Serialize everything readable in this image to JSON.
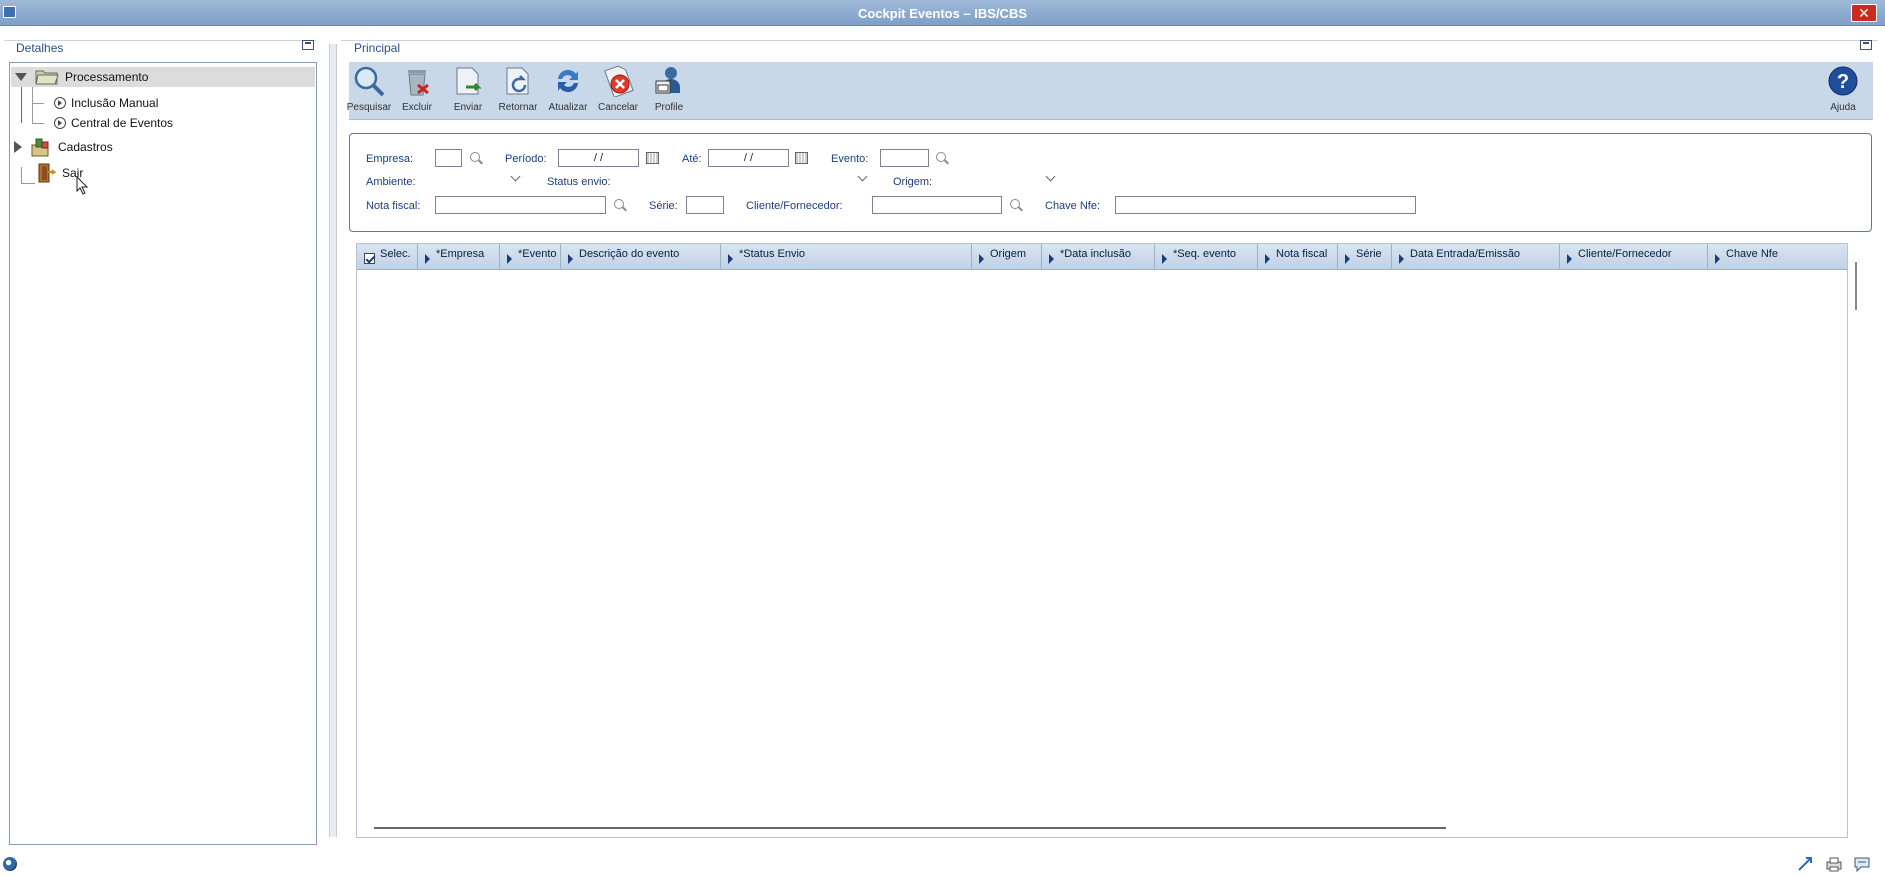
{
  "window": {
    "title": "Cockpit Eventos – IBS/CBS",
    "close_label": "✕"
  },
  "left": {
    "header": "Detalhes",
    "tree": [
      {
        "label": "Processamento"
      },
      {
        "label": "Inclusão Manual"
      },
      {
        "label": "Central de Eventos"
      },
      {
        "label": "Cadastros"
      },
      {
        "label": "Sair"
      }
    ]
  },
  "right": {
    "header": "Principal",
    "toolbar": [
      {
        "label": "Pesquisar",
        "icon": "search-icon"
      },
      {
        "label": "Excluir",
        "icon": "trash-icon"
      },
      {
        "label": "Enviar",
        "icon": "send-icon"
      },
      {
        "label": "Retornar",
        "icon": "return-icon"
      },
      {
        "label": "Atualizar",
        "icon": "refresh-icon"
      },
      {
        "label": "Cancelar",
        "icon": "cancel-icon"
      },
      {
        "label": "Profile",
        "icon": "profile-icon"
      }
    ],
    "help_label": "Ajuda",
    "filters": {
      "empresa_label": "Empresa:",
      "empresa_value": "",
      "periodo_label": "Período:",
      "periodo_value": "/ /",
      "ate_label": "Até:",
      "ate_value": "/ /",
      "evento_label": "Evento:",
      "evento_value": "",
      "ambiente_label": "Ambiente:",
      "status_envio_label": "Status envio:",
      "origem_label": "Origem:",
      "nota_fiscal_label": "Nota fiscal:",
      "nota_fiscal_value": "",
      "serie_label": "Série:",
      "serie_value": "",
      "cliente_label": "Cliente/Fornecedor:",
      "cliente_value": "",
      "chave_label": "Chave Nfe:",
      "chave_value": ""
    },
    "grid": {
      "columns": [
        "Selec.",
        "*Empresa",
        "*Evento",
        "Descrição do evento",
        "*Status Envio",
        "Origem",
        "*Data inclusão",
        "*Seq. evento",
        "Nota fiscal",
        "Série",
        "Data Entrada/Emissão",
        "Cliente/Fornecedor",
        "Chave Nfe"
      ],
      "rows": []
    }
  },
  "colors": {
    "title_bar": "#8eaccf",
    "toolbar": "#c8d8e8",
    "accent": "#2a4f86",
    "close": "#c92b1f"
  }
}
